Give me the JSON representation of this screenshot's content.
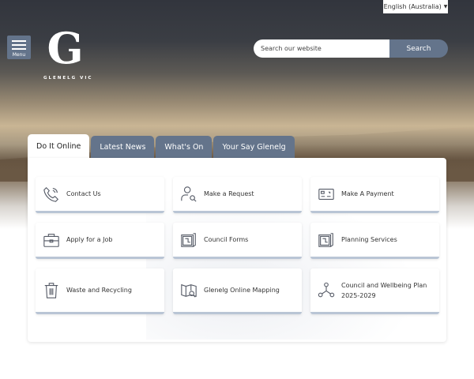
{
  "language": {
    "selected": "English (Australia)"
  },
  "menu": {
    "label": "Menu"
  },
  "logo": {
    "letter": "G",
    "text": "GLENELG VIC"
  },
  "search": {
    "placeholder": "Search our website",
    "button": "Search"
  },
  "tabs": [
    {
      "label": "Do It Online"
    },
    {
      "label": "Latest News"
    },
    {
      "label": "What's On"
    },
    {
      "label": "Your Say Glenelg"
    }
  ],
  "cards": [
    {
      "label": "Contact Us",
      "icon": "phone-icon"
    },
    {
      "label": "Make a Request",
      "icon": "user-search-icon"
    },
    {
      "label": "Make A Payment",
      "icon": "card-payment-icon"
    },
    {
      "label": "Apply for a Job",
      "icon": "briefcase-icon"
    },
    {
      "label": "Council Forms",
      "icon": "form-icon"
    },
    {
      "label": "Planning Services",
      "icon": "plan-icon"
    },
    {
      "label": "Waste and Recycling",
      "icon": "bin-icon"
    },
    {
      "label": "Glenelg Online Mapping",
      "icon": "map-search-icon"
    },
    {
      "label": "Council and Wellbeing Plan 2025-2029",
      "icon": "network-icon"
    }
  ]
}
